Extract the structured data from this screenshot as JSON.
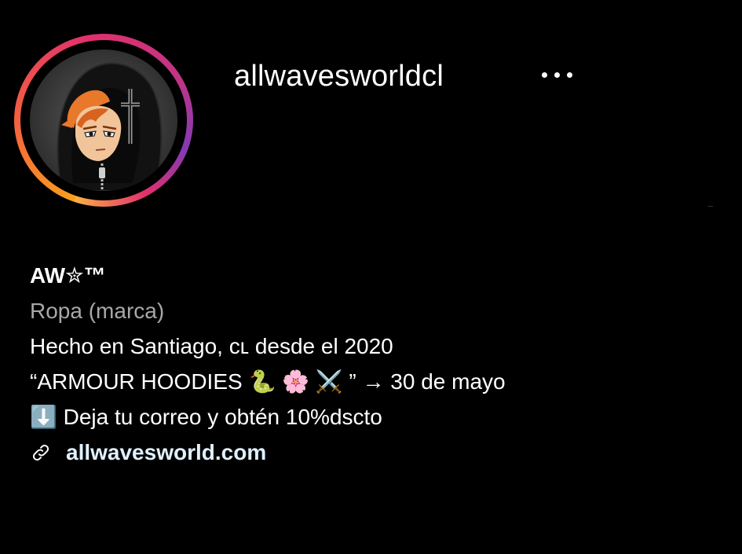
{
  "profile": {
    "username": "allwavesworldcl",
    "more_icon": "more-horizontal-icon",
    "avatar_description_icon": "avatar-image"
  },
  "bio": {
    "display_name": "AW✮™",
    "category": "Ropa (marca)",
    "line1": "Hecho en Santiago, ᴄʟ desde el 2020",
    "line2": "“ARMOUR HOODIES 🐍 🌸 ⚔️ ” → 30 de mayo",
    "line3": "⬇️ Deja tu correo y obtén 10%dscto",
    "link_text": "allwavesworld.com",
    "link_icon": "link-icon"
  },
  "colors": {
    "background": "#000000",
    "text": "#ffffff",
    "category": "#a8a8a8",
    "link": "#e0f1ff"
  }
}
